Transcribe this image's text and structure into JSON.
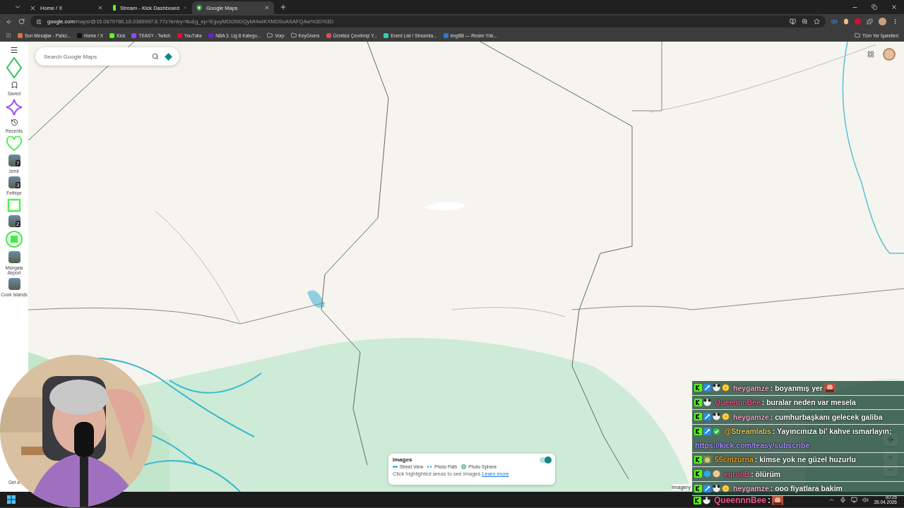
{
  "browser": {
    "tabs": [
      {
        "title": "Home / X",
        "selected": false,
        "kind": "x"
      },
      {
        "title": "Stream - Kick Dashboard",
        "selected": false,
        "kind": "kick"
      },
      {
        "title": "Google Maps",
        "selected": true,
        "kind": "maps"
      }
    ],
    "url_host": "google.com",
    "url_path": "/maps/@15.0879766,18.0389997,6.77z?entry=ttu&g_ep=EgoyMDI2MDQyMi4wIKXMDSoASAFQAw%3D%3D",
    "bookmarks": [
      {
        "label": "Son Mesajlar - Patici...",
        "kind": "site",
        "color": "#e07040"
      },
      {
        "label": "Home / X",
        "kind": "site",
        "color": "#111111"
      },
      {
        "label": "Kick",
        "kind": "site",
        "color": "#53fc18"
      },
      {
        "label": "TEASY - Twitch",
        "kind": "site",
        "color": "#9146ff"
      },
      {
        "label": "YouTube",
        "kind": "site",
        "color": "#ff0033"
      },
      {
        "label": "NBA 3. Lig 8 Katego...",
        "kind": "site",
        "color": "#6a1fd0"
      },
      {
        "label": "Vorp",
        "kind": "folder"
      },
      {
        "label": "KeyGivers",
        "kind": "folder"
      },
      {
        "label": "Ücretsiz Çevrimiçi Y...",
        "kind": "site",
        "color": "#d05050"
      },
      {
        "label": "Event List / Streamla...",
        "kind": "site",
        "color": "#30d0b0"
      },
      {
        "label": "ImgBB — Resim Yük...",
        "kind": "site",
        "color": "#2a7ad0"
      }
    ],
    "all_bookmarks": "Tüm Yer İşaretleri"
  },
  "maps": {
    "search": {
      "placeholder": "Search Google Maps"
    },
    "sidebar": [
      {
        "label": "Saved",
        "kind": "saved"
      },
      {
        "label": "Recents",
        "kind": "recents"
      },
      {
        "label": "İzmir",
        "count": "7"
      },
      {
        "label": "Fethiye",
        "count": "3"
      },
      {
        "count": "2"
      },
      {
        "label": "Mangaia Airport"
      },
      {
        "label": "Cook Islands"
      }
    ],
    "sidebar_footer": "Get a",
    "images_panel": {
      "title": "Images",
      "on": true,
      "legend": [
        {
          "label": "Street View",
          "kind": "line"
        },
        {
          "label": "Photo Path",
          "kind": "dots"
        },
        {
          "label": "Photo Sphere",
          "kind": "sphere"
        }
      ],
      "hint": "Click highlighted areas to see images",
      "link": "Learn more"
    },
    "attribution": "Imagery"
  },
  "chat": [
    {
      "badges": [
        {
          "kind": "platform"
        },
        {
          "kind": "tool"
        },
        {
          "kind": "panda"
        },
        {
          "kind": "coin"
        }
      ],
      "user": "heygamze",
      "color": "#f0a8c8",
      "text": ": boyanmış yer",
      "emote": true
    },
    {
      "badges": [
        {
          "kind": "platform"
        },
        {
          "kind": "panda"
        }
      ],
      "user": "QueennnBee",
      "color": "#e8588c",
      "text": ": buralar neden var mesela"
    },
    {
      "badges": [
        {
          "kind": "platform"
        },
        {
          "kind": "tool"
        },
        {
          "kind": "panda"
        },
        {
          "kind": "coin"
        }
      ],
      "user": "heygamze",
      "color": "#f0a8c8",
      "text": ": cumhurbaşkanı gelecek galiba"
    },
    {
      "badges": [
        {
          "kind": "platform"
        },
        {
          "kind": "tool"
        },
        {
          "kind": "check"
        }
      ],
      "user": "@Streamlabs",
      "color": "#e8c860",
      "text": ": Yayıncınıza bi' kahve ısmarlayın;",
      "link": "https://kick.com/teasy/subscribe"
    },
    {
      "badges": [
        {
          "kind": "platform"
        },
        {
          "kind": "animal"
        }
      ],
      "user": "55cmzurna",
      "color": "#f0a020",
      "text": ": kimse yok ne güzel huzurlu"
    },
    {
      "badges": [
        {
          "kind": "platform"
        },
        {
          "kind": "cube"
        },
        {
          "kind": "round"
        }
      ],
      "user": "eqrollB",
      "color": "#e8588c",
      "text": ": ölürüm"
    },
    {
      "badges": [
        {
          "kind": "platform"
        },
        {
          "kind": "tool"
        },
        {
          "kind": "panda"
        },
        {
          "kind": "coin"
        }
      ],
      "user": "heygamze",
      "color": "#f0a8c8",
      "text": ": ooo fiyatlara bakim"
    }
  ],
  "taskbar": {
    "chat": {
      "badges": [
        {
          "kind": "platform"
        },
        {
          "kind": "panda"
        }
      ],
      "user": "QueennnBee",
      "color": "#e8588c",
      "text": ":",
      "emote": true
    },
    "time": "00:25",
    "date": "26.04.2026"
  }
}
